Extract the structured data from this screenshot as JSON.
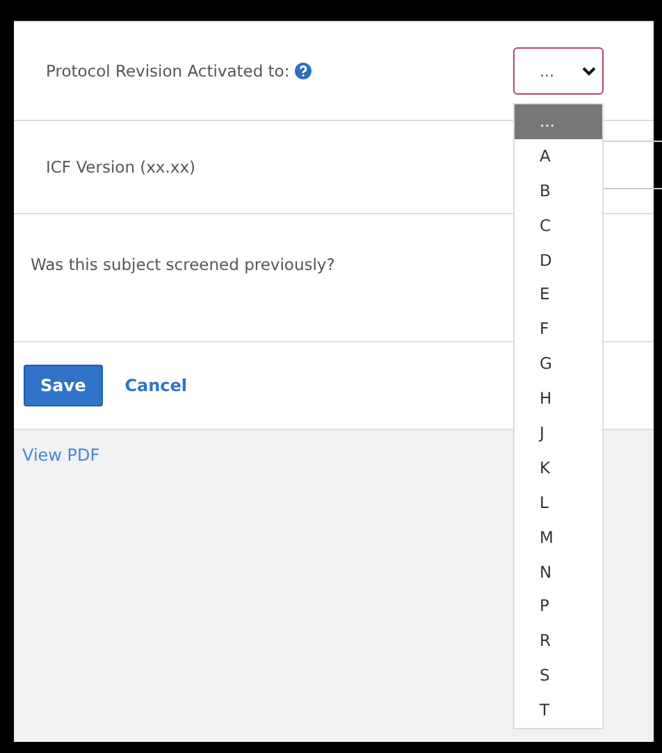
{
  "fields": [
    {
      "label": "Protocol Revision Activated to:",
      "help": true,
      "kind": "select"
    },
    {
      "label": "ICF Version (xx.xx)",
      "help": false,
      "kind": "text"
    },
    {
      "label": "Was this subject screened previously?",
      "help": false,
      "kind": "question"
    }
  ],
  "select": {
    "value": "...",
    "options": [
      {
        "label": "...",
        "selected": true
      },
      {
        "label": "A",
        "selected": false
      },
      {
        "label": "B",
        "selected": false
      },
      {
        "label": "C",
        "selected": false
      },
      {
        "label": "D",
        "selected": false
      },
      {
        "label": "E",
        "selected": false
      },
      {
        "label": "F",
        "selected": false
      },
      {
        "label": "G",
        "selected": false
      },
      {
        "label": "H",
        "selected": false
      },
      {
        "label": "J",
        "selected": false
      },
      {
        "label": "K",
        "selected": false
      },
      {
        "label": "L",
        "selected": false
      },
      {
        "label": "M",
        "selected": false
      },
      {
        "label": "N",
        "selected": false
      },
      {
        "label": "P",
        "selected": false
      },
      {
        "label": "R",
        "selected": false
      },
      {
        "label": "S",
        "selected": false
      },
      {
        "label": "T",
        "selected": false
      }
    ]
  },
  "buttons": {
    "save": "Save",
    "cancel": "Cancel"
  },
  "link": "View PDF"
}
